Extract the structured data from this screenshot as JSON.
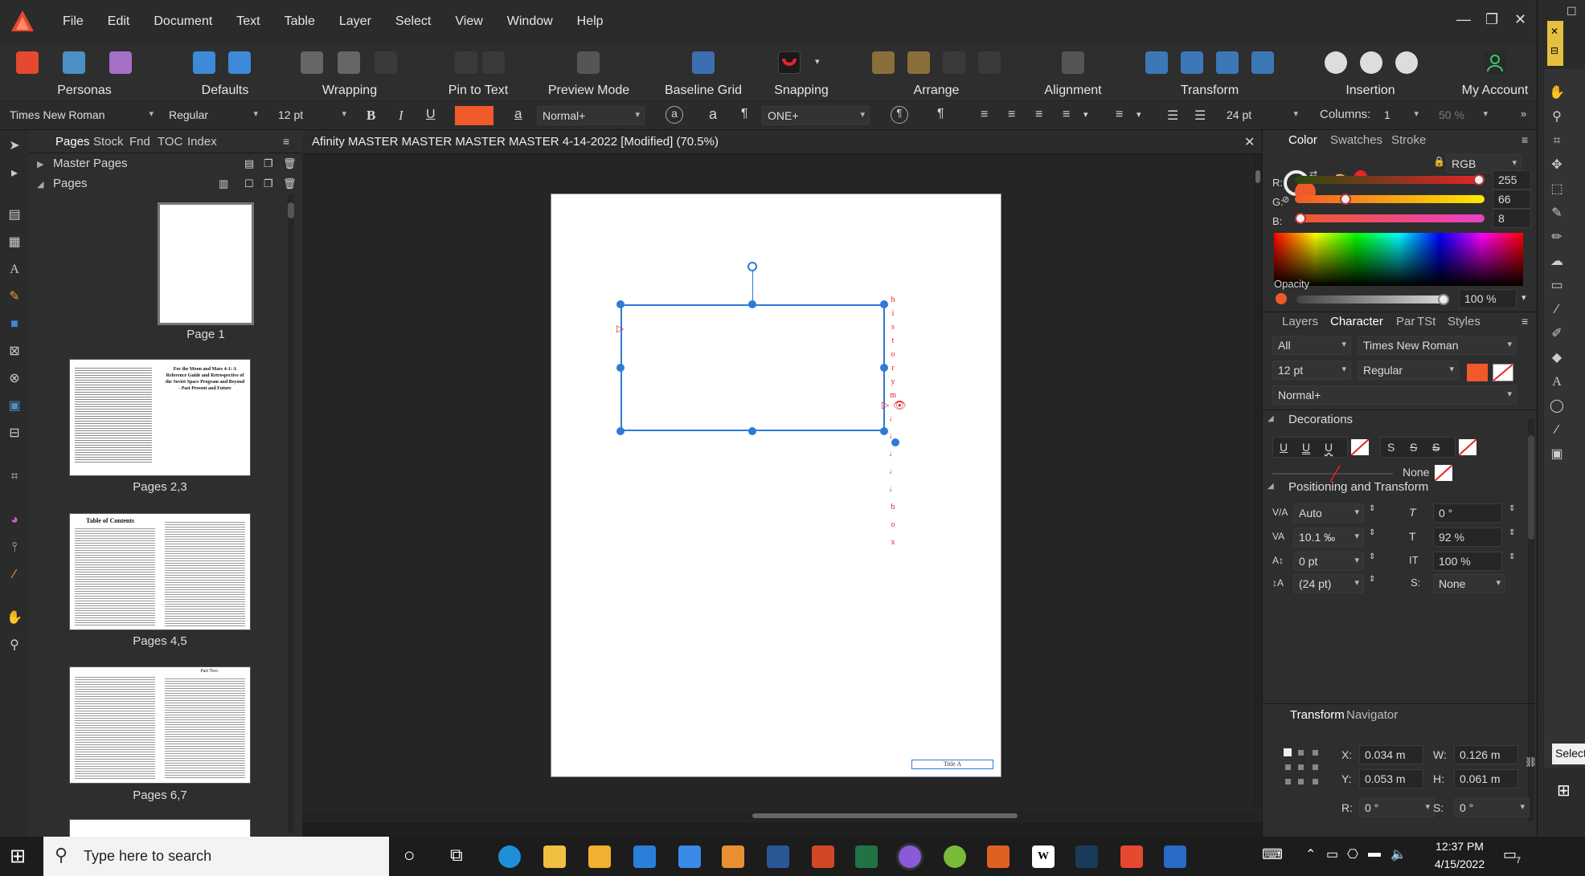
{
  "menu": {
    "items": [
      "File",
      "Edit",
      "Document",
      "Text",
      "Table",
      "Layer",
      "Select",
      "View",
      "Window",
      "Help"
    ]
  },
  "toolbar": {
    "personas": "Personas",
    "defaults": "Defaults",
    "wrapping": "Wrapping",
    "pin_to_text": "Pin to Text",
    "preview_mode": "Preview Mode",
    "baseline_grid": "Baseline Grid",
    "snapping": "Snapping",
    "arrange": "Arrange",
    "alignment": "Alignment",
    "transform": "Transform",
    "insertion": "Insertion",
    "my_account": "My Account"
  },
  "context": {
    "font": "Times New Roman",
    "style": "Regular",
    "size": "12 pt",
    "bold": "B",
    "italic": "I",
    "underline": "U",
    "para_style": "Normal+",
    "char_a": "a",
    "pilcrow": "¶",
    "text_style": "ONE+",
    "leading": "24 pt",
    "columns_label": "Columns:",
    "columns": "1",
    "zoom_percent": "50 %",
    "fill_color": "#f05a28"
  },
  "pages_panel": {
    "tabs": [
      "Pages",
      "Stock",
      "Fnd",
      "TOC",
      "Index"
    ],
    "master_pages": "Master Pages",
    "pages": "Pages",
    "thumbs": [
      "Page 1",
      "Pages 2,3",
      "Pages 4,5",
      "Pages 6,7"
    ],
    "thumb_texts": {
      "t2": "For the Moon and Mars 4-1: A Reference Guide and Retrospective of the Soviet Space Program and Beyond - Past Present and Future",
      "t3": "Table of Contents",
      "t4": "Part Two"
    }
  },
  "document": {
    "title": "Afinity MASTER MASTER MASTER MASTER 4-14-2022 [Modified] (70.5%)",
    "title_box": "Title A",
    "vertical_letters": [
      "h",
      "i",
      "s",
      "t",
      "o",
      "r",
      "y",
      "m",
      "♩",
      "♩",
      "♩",
      "♩",
      "♩",
      "b",
      "o",
      "x"
    ]
  },
  "right_panel": {
    "color_tabs": [
      "Color",
      "Swatches",
      "Stroke"
    ],
    "color_model": "RGB",
    "r_label": "R:",
    "r_value": "255",
    "g_label": "G:",
    "g_value": "66",
    "b_label": "B:",
    "b_value": "8",
    "opacity_label": "Opacity",
    "opacity_value": "100 %",
    "char_tabs": [
      "Layers",
      "Character",
      "Par",
      "TSt",
      "Styles"
    ],
    "scope": "All",
    "font": "Times New Roman",
    "size": "12 pt",
    "style": "Regular",
    "para_style": "Normal+",
    "decorations": "Decorations",
    "deco_none": "None",
    "pos_transform": "Positioning and Transform",
    "kerning": "Auto",
    "shear": "0 °",
    "tracking": "10.1 ‰",
    "vscale": "92 %",
    "baseline": "0 pt",
    "hscale": "100 %",
    "leading": "(24 pt)",
    "script": "None",
    "script_label": "S:",
    "transform_tabs": [
      "Transform",
      "Navigator"
    ],
    "x_label": "X:",
    "x": "0.034 m",
    "w_label": "W:",
    "w": "0.126 m",
    "y_label": "Y:",
    "y": "0.053 m",
    "h_label": "H:",
    "h": "0.061 m",
    "r_rot_label": "R:",
    "r_rot": "0 °",
    "s_label": "S:",
    "s": "0 °",
    "selection": "Selecti"
  },
  "taskbar": {
    "search_placeholder": "Type here to search",
    "time": "12:37 PM",
    "date": "4/15/2022",
    "notifications": "7"
  },
  "colors": {
    "accent_orange": "#f05a28",
    "selection_blue": "#2f79d8",
    "marker_red": "#e8232a"
  }
}
